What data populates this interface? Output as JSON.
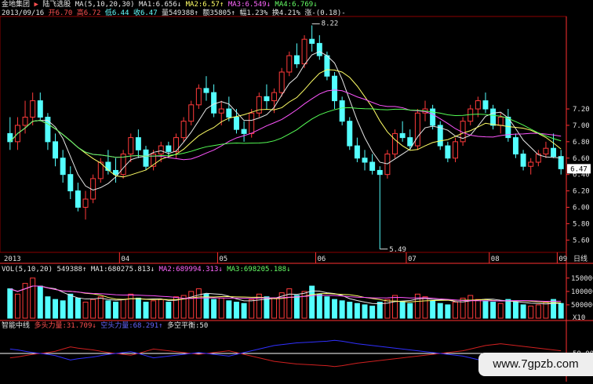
{
  "window": {
    "stock_name": "金地集团",
    "tab_label": "陆飞选股"
  },
  "header": {
    "ma_label": "MA(5,10,20,30)",
    "ma1": "MA1:6.656↓",
    "ma2": "MA2:6.57↑",
    "ma3": "MA3:6.549↓",
    "ma4": "MA4:6.769↓",
    "date": "2013/09/16",
    "open": "开6.70",
    "high": "高6.72",
    "low": "低6.44",
    "close": "收6.47",
    "volume": "量549388↑",
    "amount": "额35805↑",
    "change_pct": "幅1.23%",
    "turnover": "换4.21%",
    "diff": "涨-(0.18)-"
  },
  "colors": {
    "up": "#ff3a3a",
    "down": "#54ffff",
    "ma5": "#e6e6e6",
    "ma10": "#ffff66",
    "ma20": "#ff55ff",
    "ma30": "#55ff55",
    "grid": "#8b0000",
    "axis": "#ff3030"
  },
  "price_axis": {
    "ticks": [
      "7.20",
      "7.00",
      "6.80",
      "6.60",
      "6.40",
      "6.20",
      "6.00",
      "5.80",
      "5.60"
    ],
    "current": "6.47"
  },
  "annotations": {
    "high": "8.22",
    "low": "5.49"
  },
  "time_axis": {
    "labels": [
      "2013",
      "04",
      "05",
      "06",
      "07",
      "08",
      "09"
    ],
    "period": "日线"
  },
  "volume_panel": {
    "label": "VOL(5,10,20)",
    "vol": "549388↑",
    "ma1": "MA1:680275.813↓",
    "ma2": "MA2:689994.313↓",
    "ma3": "MA3:698205.188↓",
    "ticks": [
      "1500000",
      "1000000",
      "500000"
    ],
    "unit": "X10"
  },
  "indicator_panel": {
    "name": "智能中线",
    "bull": "多头力量:31.709↓",
    "bear": "空头力量:68.291↑",
    "balance": "多空平衡:50",
    "tick": "50.00"
  },
  "watermark": "www.7gpzb.com",
  "chart_data": [
    {
      "type": "candlestick",
      "ylim": [
        5.45,
        8.3
      ],
      "series_names": [
        "MA5",
        "MA10",
        "MA20",
        "MA30"
      ],
      "x": [
        "2013",
        "04",
        "05",
        "06",
        "07",
        "08",
        "09"
      ],
      "ohlc": [
        [
          6.9,
          7.1,
          6.7,
          6.8
        ],
        [
          6.8,
          7.1,
          6.7,
          7.0
        ],
        [
          7.0,
          7.3,
          6.9,
          7.1
        ],
        [
          7.1,
          7.4,
          7.0,
          7.3
        ],
        [
          7.3,
          7.4,
          7.05,
          7.1
        ],
        [
          7.1,
          7.15,
          6.7,
          6.8
        ],
        [
          6.8,
          6.9,
          6.5,
          6.6
        ],
        [
          6.6,
          6.7,
          6.3,
          6.4
        ],
        [
          6.4,
          6.5,
          6.1,
          6.2
        ],
        [
          6.2,
          6.3,
          5.95,
          6.0
        ],
        [
          6.0,
          6.2,
          5.85,
          6.1
        ],
        [
          6.1,
          6.4,
          6.05,
          6.35
        ],
        [
          6.35,
          6.6,
          6.3,
          6.55
        ],
        [
          6.55,
          6.7,
          6.4,
          6.45
        ],
        [
          6.45,
          6.6,
          6.3,
          6.4
        ],
        [
          6.4,
          6.7,
          6.35,
          6.65
        ],
        [
          6.65,
          6.9,
          6.55,
          6.85
        ],
        [
          6.85,
          6.95,
          6.6,
          6.7
        ],
        [
          6.7,
          6.75,
          6.45,
          6.5
        ],
        [
          6.5,
          6.7,
          6.45,
          6.65
        ],
        [
          6.65,
          6.8,
          6.55,
          6.75
        ],
        [
          6.75,
          6.8,
          6.6,
          6.68
        ],
        [
          6.68,
          6.9,
          6.6,
          6.85
        ],
        [
          6.85,
          7.1,
          6.8,
          7.05
        ],
        [
          7.05,
          7.3,
          7.0,
          7.25
        ],
        [
          7.25,
          7.5,
          7.2,
          7.45
        ],
        [
          7.45,
          7.6,
          7.3,
          7.4
        ],
        [
          7.4,
          7.5,
          7.1,
          7.15
        ],
        [
          7.15,
          7.3,
          7.0,
          7.2
        ],
        [
          7.2,
          7.35,
          7.05,
          7.1
        ],
        [
          7.1,
          7.2,
          6.9,
          6.95
        ],
        [
          6.95,
          7.05,
          6.8,
          6.9
        ],
        [
          6.9,
          7.2,
          6.85,
          7.15
        ],
        [
          7.15,
          7.4,
          7.1,
          7.35
        ],
        [
          7.35,
          7.5,
          7.2,
          7.3
        ],
        [
          7.3,
          7.45,
          7.15,
          7.4
        ],
        [
          7.4,
          7.7,
          7.35,
          7.65
        ],
        [
          7.65,
          7.9,
          7.6,
          7.85
        ],
        [
          7.85,
          8.0,
          7.7,
          7.75
        ],
        [
          7.75,
          8.1,
          7.7,
          8.05
        ],
        [
          8.05,
          8.22,
          7.9,
          8.0
        ],
        [
          8.0,
          8.1,
          7.8,
          7.85
        ],
        [
          7.85,
          7.9,
          7.55,
          7.6
        ],
        [
          7.6,
          7.65,
          7.2,
          7.3
        ],
        [
          7.3,
          7.35,
          7.0,
          7.05
        ],
        [
          7.05,
          7.1,
          6.7,
          6.75
        ],
        [
          6.75,
          6.85,
          6.55,
          6.6
        ],
        [
          6.6,
          6.7,
          6.45,
          6.55
        ],
        [
          6.55,
          6.65,
          6.4,
          6.45
        ],
        [
          6.45,
          6.5,
          5.49,
          6.4
        ],
        [
          6.4,
          6.7,
          6.35,
          6.65
        ],
        [
          6.65,
          6.95,
          6.6,
          6.9
        ],
        [
          6.9,
          7.05,
          6.8,
          6.85
        ],
        [
          6.85,
          6.95,
          6.7,
          6.75
        ],
        [
          6.75,
          7.2,
          6.7,
          7.15
        ],
        [
          7.15,
          7.3,
          7.05,
          7.2
        ],
        [
          7.2,
          7.25,
          6.95,
          7.0
        ],
        [
          7.0,
          7.05,
          6.7,
          6.75
        ],
        [
          6.75,
          6.8,
          6.55,
          6.6
        ],
        [
          6.6,
          6.85,
          6.55,
          6.8
        ],
        [
          6.8,
          7.1,
          6.75,
          7.05
        ],
        [
          7.05,
          7.25,
          7.0,
          7.2
        ],
        [
          7.2,
          7.35,
          7.1,
          7.3
        ],
        [
          7.3,
          7.4,
          7.15,
          7.2
        ],
        [
          7.2,
          7.25,
          6.95,
          7.0
        ],
        [
          7.0,
          7.15,
          6.9,
          7.1
        ],
        [
          7.1,
          7.2,
          6.8,
          6.85
        ],
        [
          6.85,
          6.9,
          6.6,
          6.65
        ],
        [
          6.65,
          6.7,
          6.45,
          6.5
        ],
        [
          6.5,
          6.6,
          6.4,
          6.55
        ],
        [
          6.55,
          6.7,
          6.5,
          6.65
        ],
        [
          6.65,
          6.8,
          6.6,
          6.72
        ],
        [
          6.72,
          6.9,
          6.6,
          6.62
        ],
        [
          6.62,
          6.7,
          6.4,
          6.47
        ]
      ]
    },
    {
      "type": "bar",
      "name": "volume",
      "ylim": [
        0,
        1700000
      ],
      "values": [
        1100000,
        900000,
        1300000,
        1500000,
        1200000,
        800000,
        700000,
        650000,
        900000,
        750000,
        600000,
        700000,
        800000,
        650000,
        600000,
        700000,
        900000,
        750000,
        600000,
        650000,
        700000,
        600000,
        800000,
        850000,
        1000000,
        1100000,
        900000,
        700000,
        750000,
        650000,
        600000,
        550000,
        700000,
        900000,
        800000,
        750000,
        950000,
        1100000,
        850000,
        1000000,
        1200000,
        900000,
        800000,
        700000,
        650000,
        600000,
        550000,
        500000,
        450000,
        600000,
        700000,
        850000,
        600000,
        550000,
        900000,
        800000,
        650000,
        550000,
        500000,
        600000,
        750000,
        850000,
        700000,
        650000,
        600000,
        550000,
        700000,
        600000,
        500000,
        450000,
        500000,
        600000,
        700000,
        550000
      ]
    },
    {
      "type": "line",
      "name": "indicator",
      "series_names": [
        "多头力量",
        "空头力量"
      ],
      "ylim": [
        0,
        100
      ],
      "bull": [
        40,
        42,
        45,
        48,
        50,
        52,
        55,
        60,
        65,
        62,
        60,
        58,
        55,
        52,
        50,
        48,
        46,
        50,
        55,
        60,
        58,
        56,
        54,
        52,
        50,
        48,
        50,
        52,
        54,
        56,
        52,
        48,
        44,
        40,
        36,
        32,
        30,
        28,
        26,
        25,
        24,
        23,
        22,
        20,
        22,
        25,
        28,
        30,
        32,
        34,
        36,
        38,
        40,
        42,
        44,
        46,
        48,
        50,
        52,
        54,
        56,
        60,
        64,
        68,
        70,
        72,
        70,
        68,
        66,
        64,
        62,
        60,
        58,
        56
      ],
      "bear": [
        60,
        58,
        55,
        52,
        50,
        48,
        45,
        40,
        35,
        38,
        40,
        42,
        45,
        48,
        50,
        52,
        54,
        50,
        45,
        40,
        42,
        44,
        46,
        48,
        50,
        52,
        50,
        48,
        46,
        44,
        48,
        52,
        56,
        60,
        64,
        68,
        70,
        72,
        74,
        75,
        76,
        77,
        78,
        80,
        78,
        75,
        72,
        70,
        68,
        66,
        64,
        62,
        60,
        58,
        56,
        54,
        52,
        50,
        48,
        46,
        44,
        40,
        36,
        32,
        30,
        28,
        30,
        32,
        34,
        36,
        38,
        40,
        42,
        44
      ]
    }
  ]
}
